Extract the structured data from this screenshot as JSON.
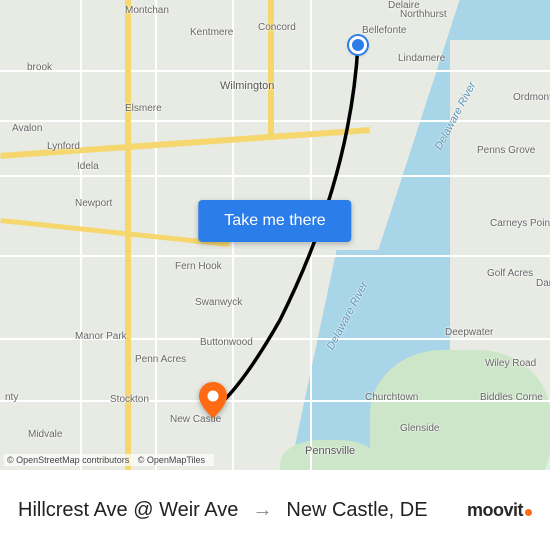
{
  "route": {
    "origin_label": "Hillcrest Ave @ Weir Ave",
    "destination_label": "New Castle, DE"
  },
  "cta": {
    "label": "Take me there"
  },
  "attribution": {
    "osm": "© OpenStreetMap contributors",
    "omt": "© OpenMapTiles"
  },
  "brand": {
    "name": "moovit"
  },
  "map_labels": {
    "wilmington": "Wilmington",
    "elsmere": "Elsmere",
    "newport": "Newport",
    "new_castle": "New Castle",
    "pennsville": "Pennsville",
    "bellefonte": "Bellefonte",
    "lindamere": "Lindamere",
    "concord": "Concord",
    "kentmere": "Kentmere",
    "montchan": "Montchan",
    "northhurst": "Northhurst",
    "delaire": "Delaire",
    "brook": "brook",
    "avalon": "Avalon",
    "lynford": "Lynford",
    "idela": "Idela",
    "fern_hook": "Fern Hook",
    "swanwyck": "Swanwyck",
    "buttonwood": "Buttonwood",
    "manor_park": "Manor Park",
    "penn_acres": "Penn Acres",
    "stockton": "Stockton",
    "midvale": "Midvale",
    "nty": "nty",
    "ordmont": "Ordmont",
    "penns_grove": "Penns Grove",
    "carneys_point": "Carneys Point",
    "golf_acres": "Golf Acres",
    "danc": "Danc",
    "deepwater": "Deepwater",
    "wiley_road": "Wiley Road",
    "biddles_corne": "Biddles Corne",
    "churchtown": "Churchtown",
    "glenside": "Glenside",
    "river1": "Delaware River",
    "river2": "Delaware River"
  }
}
